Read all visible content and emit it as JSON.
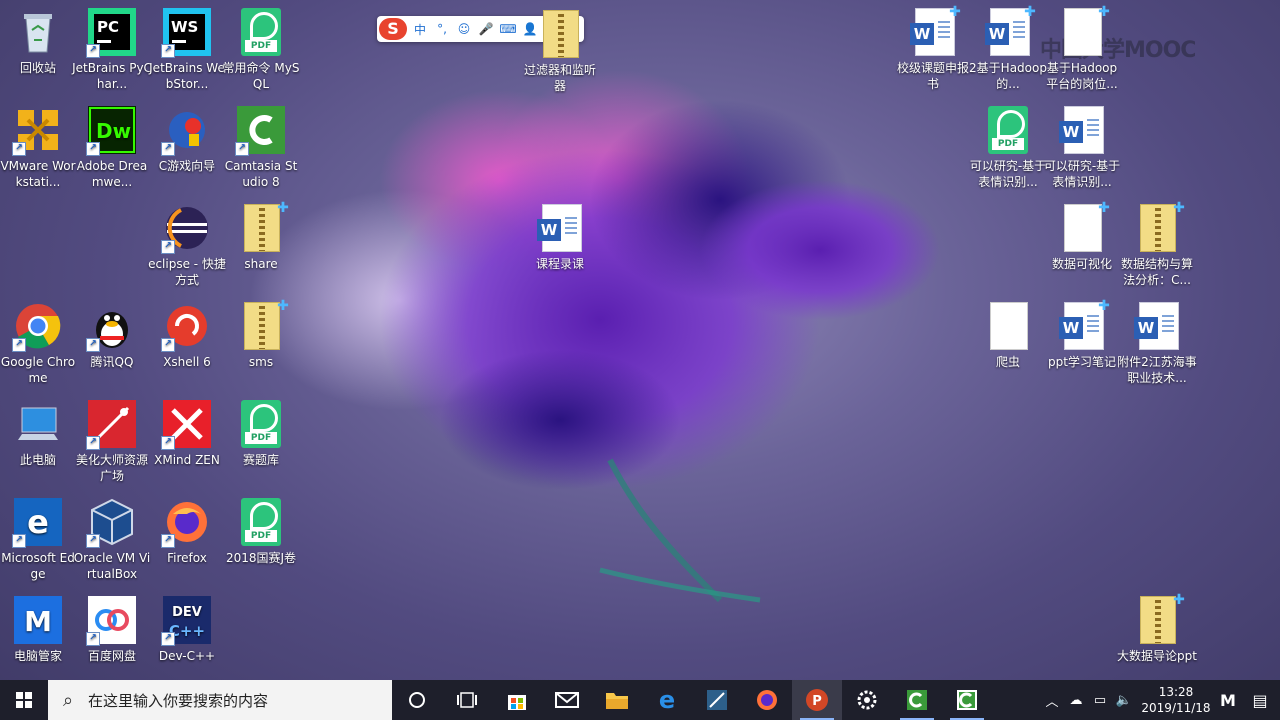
{
  "desktop": {
    "icons": [
      {
        "id": "recycle",
        "label": "回收站",
        "icon": "recycle-bin-icon"
      },
      {
        "id": "pycharm",
        "label": "JetBrains PyChar...",
        "icon": "pycharm-icon"
      },
      {
        "id": "webstorm",
        "label": "JetBrains WebStor...",
        "icon": "webstorm-icon"
      },
      {
        "id": "mysql",
        "label": "常用命令 MySQL",
        "icon": "pdf-icon"
      },
      {
        "id": "vmware",
        "label": "VMware Workstati...",
        "icon": "vmware-icon"
      },
      {
        "id": "dreamweaver",
        "label": "Adobe Dreamwe...",
        "icon": "dreamweaver-icon"
      },
      {
        "id": "cgame",
        "label": "C游戏向导",
        "icon": "c-game-icon"
      },
      {
        "id": "camtasia",
        "label": "Camtasia Studio 8",
        "icon": "camtasia-icon"
      },
      {
        "id": "eclipse",
        "label": "eclipse - 快捷方式",
        "icon": "eclipse-icon"
      },
      {
        "id": "share",
        "label": "share",
        "icon": "zip-folder-icon"
      },
      {
        "id": "chrome",
        "label": "Google Chrome",
        "icon": "chrome-icon"
      },
      {
        "id": "qq",
        "label": "腾讯QQ",
        "icon": "qq-icon"
      },
      {
        "id": "xshell",
        "label": "Xshell 6",
        "icon": "xshell-icon"
      },
      {
        "id": "sms",
        "label": "sms",
        "icon": "zip-folder-icon"
      },
      {
        "id": "thispc",
        "label": "此电脑",
        "icon": "computer-icon"
      },
      {
        "id": "meihua",
        "label": "美化大师资源广场",
        "icon": "meihua-icon"
      },
      {
        "id": "xmind",
        "label": "XMind ZEN",
        "icon": "xmind-icon"
      },
      {
        "id": "saiti",
        "label": "赛题库",
        "icon": "pdf-icon"
      },
      {
        "id": "edge",
        "label": "Microsoft Edge",
        "icon": "edge-icon"
      },
      {
        "id": "virtualbox",
        "label": "Oracle VM VirtualBox",
        "icon": "virtualbox-icon"
      },
      {
        "id": "firefox",
        "label": "Firefox",
        "icon": "firefox-icon"
      },
      {
        "id": "guosai",
        "label": "2018国赛J卷",
        "icon": "pdf-icon"
      },
      {
        "id": "pcmgr",
        "label": "电脑管家",
        "icon": "pc-manager-icon"
      },
      {
        "id": "baidupan",
        "label": "百度网盘",
        "icon": "baidu-netdisk-icon"
      },
      {
        "id": "devcpp",
        "label": "Dev-C++",
        "icon": "devcpp-icon"
      },
      {
        "id": "filter",
        "label": "过滤器和监听器",
        "icon": "zip-folder-icon"
      },
      {
        "id": "kecheng",
        "label": "课程录课",
        "icon": "word-doc-icon"
      },
      {
        "id": "jiaoji",
        "label": "校级课题申报书",
        "icon": "word-doc-icon"
      },
      {
        "id": "hadoop2",
        "label": "2基于Hadoop的...",
        "icon": "word-doc-icon"
      },
      {
        "id": "hadoop-job",
        "label": "基于Hadoop平台的岗位...",
        "icon": "plain-doc-icon"
      },
      {
        "id": "research-pdf",
        "label": "可以研究-基于表情识别...",
        "icon": "pdf-icon"
      },
      {
        "id": "research-doc",
        "label": "可以研究-基于表情识别...",
        "icon": "word-doc-icon"
      },
      {
        "id": "dataviz",
        "label": "数据可视化",
        "icon": "plain-doc-icon"
      },
      {
        "id": "datastruct",
        "label": "数据结构与算法分析：C...",
        "icon": "zip-folder-icon"
      },
      {
        "id": "crawler",
        "label": "爬虫",
        "icon": "plain-doc-icon"
      },
      {
        "id": "pptnotes",
        "label": "ppt学习笔记",
        "icon": "word-doc-icon"
      },
      {
        "id": "attach2",
        "label": "附件2江苏海事职业技术...",
        "icon": "word-doc-icon"
      },
      {
        "id": "bigdata",
        "label": "大数据导论ppt",
        "icon": "zip-folder-icon"
      }
    ]
  },
  "ime_toolbar": {
    "logo": "S",
    "items": [
      "中",
      "°,",
      "☺",
      "🎤",
      "⌨",
      "👤",
      "👕",
      "▦"
    ]
  },
  "watermark": "中国大学MOOC",
  "taskbar": {
    "search_placeholder": "在这里输入你要搜索的内容",
    "apps": [
      {
        "name": "cortana",
        "icon": "cortana-icon",
        "running": false
      },
      {
        "name": "task-view",
        "icon": "task-view-icon",
        "running": false
      },
      {
        "name": "store",
        "icon": "store-icon",
        "running": false
      },
      {
        "name": "mail",
        "icon": "mail-icon",
        "running": false
      },
      {
        "name": "file-explorer",
        "icon": "folder-icon",
        "running": false
      },
      {
        "name": "edge",
        "icon": "edge-icon",
        "running": false
      },
      {
        "name": "vmware",
        "icon": "vmware-icon",
        "running": false
      },
      {
        "name": "firefox",
        "icon": "firefox-icon",
        "running": false
      },
      {
        "name": "powerpoint",
        "icon": "powerpoint-icon",
        "running": true
      },
      {
        "name": "settings",
        "icon": "gear-icon",
        "running": false
      },
      {
        "name": "camtasia-recorder",
        "icon": "camtasia-icon",
        "running": true
      },
      {
        "name": "camtasia",
        "icon": "camtasia-icon",
        "running": true
      }
    ],
    "clock_time": "13:28",
    "clock_date": "2019/11/18"
  },
  "colors": {
    "taskbar": "#1e1f2b",
    "pdf_green": "#2cc47c",
    "word_blue": "#2b5fb4"
  }
}
